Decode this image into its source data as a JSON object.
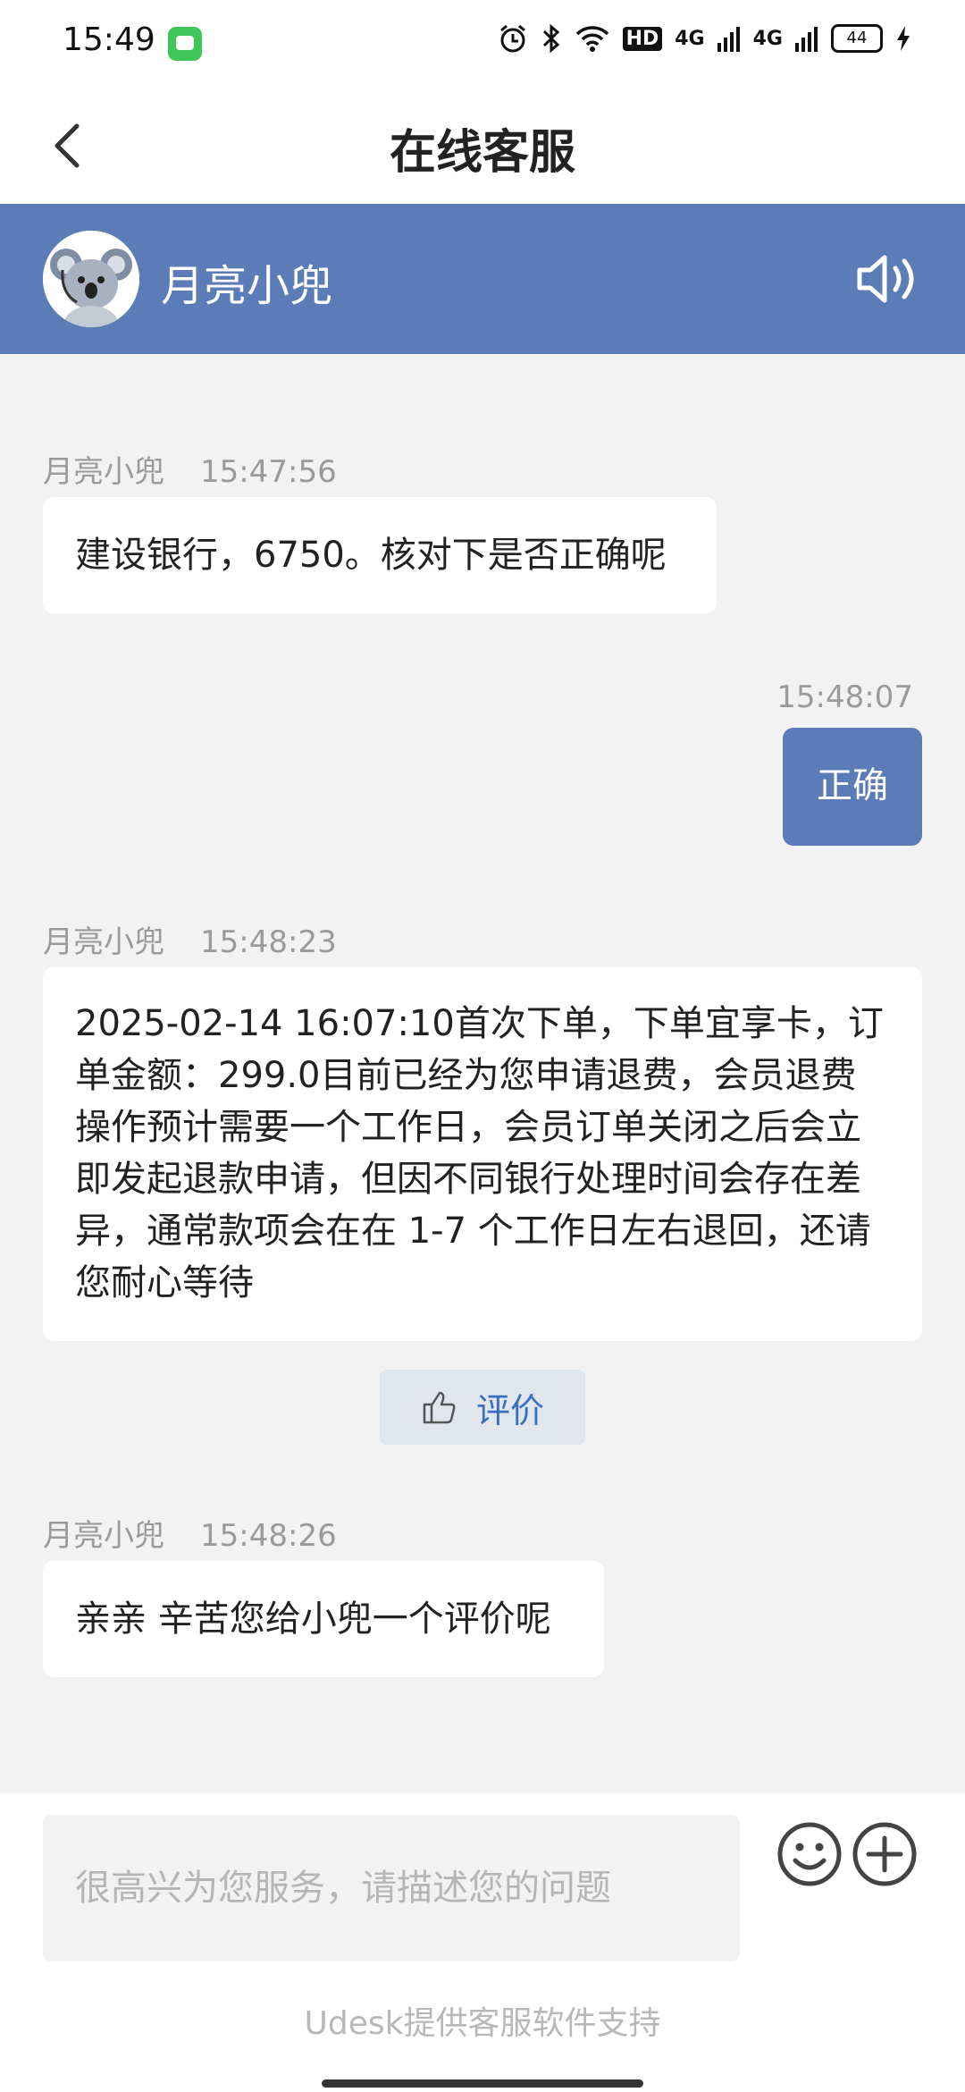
{
  "status_bar": {
    "time": "15:49",
    "hd_label": "HD",
    "network_1": "4G",
    "network_2": "4G",
    "battery": "44"
  },
  "header": {
    "title": "在线客服"
  },
  "agent": {
    "name": "月亮小兜"
  },
  "messages": [
    {
      "side": "left",
      "sender": "月亮小兜",
      "time": "15:47:56",
      "text": "建设银行，6750。核对下是否正确呢"
    },
    {
      "side": "right",
      "sender": "",
      "time": "15:48:07",
      "text": "正确"
    },
    {
      "side": "left",
      "sender": "月亮小兜",
      "time": "15:48:23",
      "text": "2025-02-14 16:07:10首次下单，下单宜享卡，订单金额：299.0目前已经为您申请退费，会员退费操作预计需要一个工作日，会员订单关闭之后会立即发起退款申请，但因不同银行处理时间会存在差异，通常款项会在在 1-7 个工作日左右退回，还请您耐心等待"
    },
    {
      "side": "left",
      "sender": "月亮小兜",
      "time": "15:48:26",
      "text": "亲亲 辛苦您给小兜一个评价呢"
    }
  ],
  "rate_button": {
    "label": "评价"
  },
  "input": {
    "placeholder": "很高兴为您服务，请描述您的问题"
  },
  "footer": {
    "powered_by": "Udesk提供客服软件支持"
  },
  "colors": {
    "accent": "#5c7cb8",
    "rate_text": "#3a6fc0",
    "background": "#f2f2f2"
  }
}
